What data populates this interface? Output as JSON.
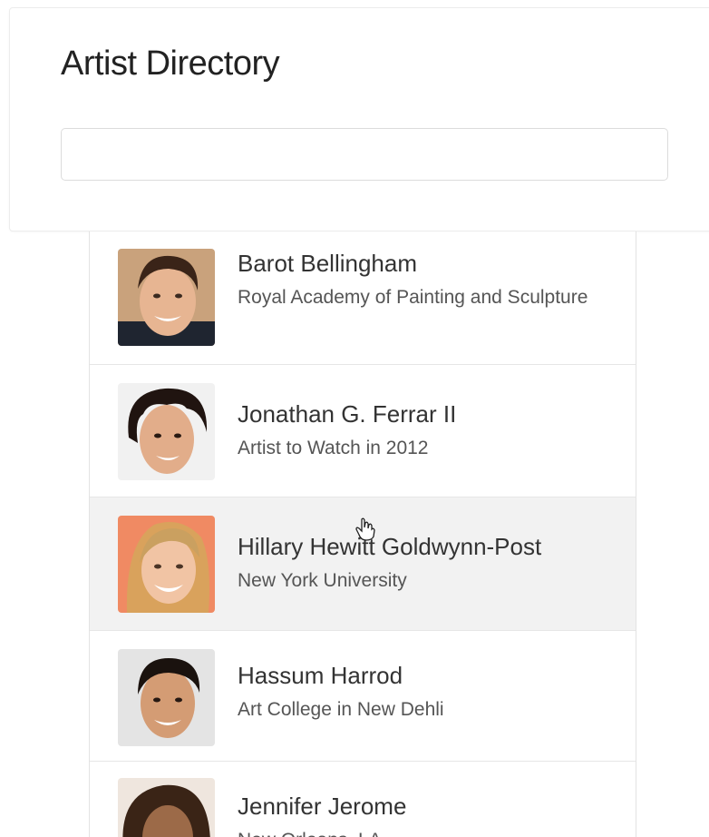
{
  "page": {
    "title": "Artist Directory"
  },
  "search": {
    "value": "",
    "placeholder": ""
  },
  "artists": [
    {
      "name": "Barot Bellingham",
      "reknown": "Royal Academy of Painting and Sculpture",
      "avatar": "man-short-hair-portrait"
    },
    {
      "name": "Jonathan G. Ferrar II",
      "reknown": "Artist to Watch in 2012",
      "avatar": "man-curly-hair-portrait"
    },
    {
      "name": "Hillary Hewitt Goldwynn-Post",
      "reknown": "New York University",
      "avatar": "woman-blonde-portrait"
    },
    {
      "name": "Hassum Harrod",
      "reknown": "Art College in New Dehli",
      "avatar": "man-dark-hair-portrait"
    },
    {
      "name": "Jennifer Jerome",
      "reknown": "New Orleans, LA",
      "avatar": "woman-curly-hair-portrait"
    }
  ],
  "colors": {
    "hover_row": "#f2f2f2",
    "border": "#e6e6e6",
    "title": "#222222"
  }
}
